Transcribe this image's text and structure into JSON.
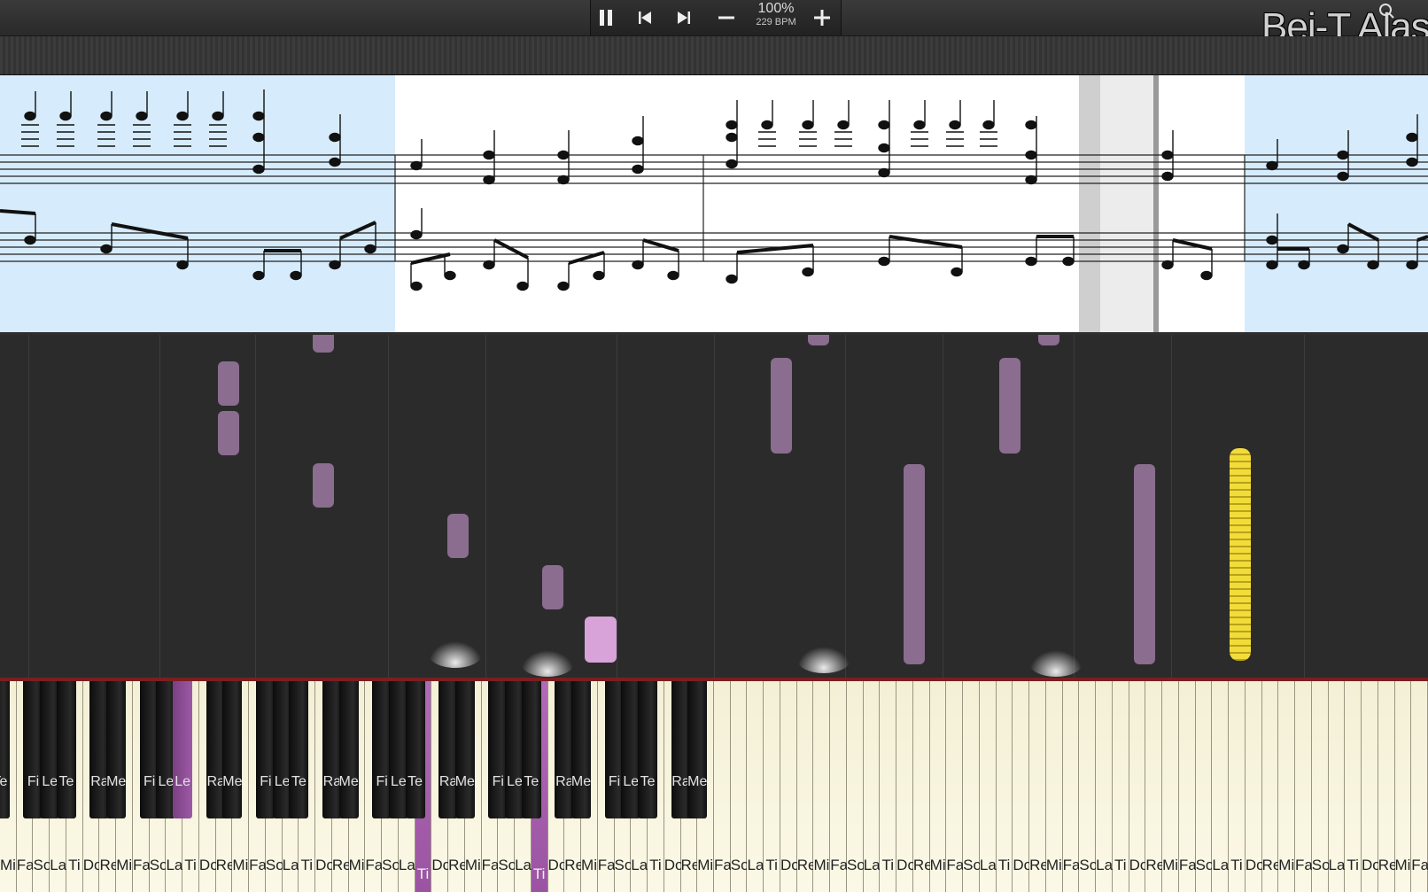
{
  "toolbar": {
    "speed_percent": "100%",
    "tempo": "229 BPM",
    "pause_icon": "pause-icon",
    "previous_icon": "skip-back-icon",
    "next_icon": "skip-forward-icon",
    "slower_icon": "minus-icon",
    "faster_icon": "plus-icon"
  },
  "watermark": "Bei-T Alas",
  "colors": {
    "falling_note": "#8a6d8f",
    "falling_note_active": "#d7a3d8",
    "gold_note": "#f2dc3a",
    "key_active": "#a75eae",
    "hit_line": "#7a1f22"
  },
  "keyboard": {
    "white_keys": [
      "Mi",
      "Fa",
      "So",
      "La",
      "Ti",
      "Do",
      "Re",
      "Mi",
      "Fa",
      "So",
      "La",
      "Ti",
      "Do",
      "Re",
      "Mi",
      "Fa",
      "So",
      "La",
      "Ti",
      "Do",
      "Re",
      "Mi",
      "Fa",
      "So",
      "La",
      "Ti",
      "Do",
      "Re",
      "Mi",
      "Fa",
      "So",
      "La",
      "Ti",
      "Do",
      "Re",
      "Mi",
      "Fa",
      "So",
      "La",
      "Ti",
      "Do",
      "Re",
      "Mi",
      "Fa",
      "So",
      "La",
      "Ti",
      "Do",
      "Re",
      "Mi",
      "Fa",
      "So",
      "La",
      "Ti",
      "Do",
      "Re",
      "Mi",
      "Fa",
      "So",
      "La",
      "Ti",
      "Do",
      "Re",
      "Mi",
      "Fa",
      "So",
      "La",
      "Ti",
      "Do",
      "Re",
      "Mi",
      "Fa",
      "So",
      "La",
      "Ti",
      "Do",
      "Re",
      "Mi",
      "Fa",
      "So",
      "La",
      "Ti",
      "Do",
      "Re",
      "Mi",
      "Fa"
    ],
    "black_keys": [
      "Te",
      "Fi",
      "Le",
      "Te",
      "Ra",
      "Me",
      "Fi",
      "Le",
      "Te",
      "Ra",
      "Me",
      "Fi",
      "Le",
      "Te",
      "Ra",
      "Me",
      "Fi",
      "Le",
      "Te",
      "Ra",
      "Me",
      "Fi",
      "Le",
      "Te",
      "Ra",
      "Me",
      "Fi",
      "Le",
      "Te",
      "Ra",
      "Me"
    ],
    "active_white_labels": [
      "Ti",
      "Ti"
    ],
    "active_black_label": "Le"
  }
}
